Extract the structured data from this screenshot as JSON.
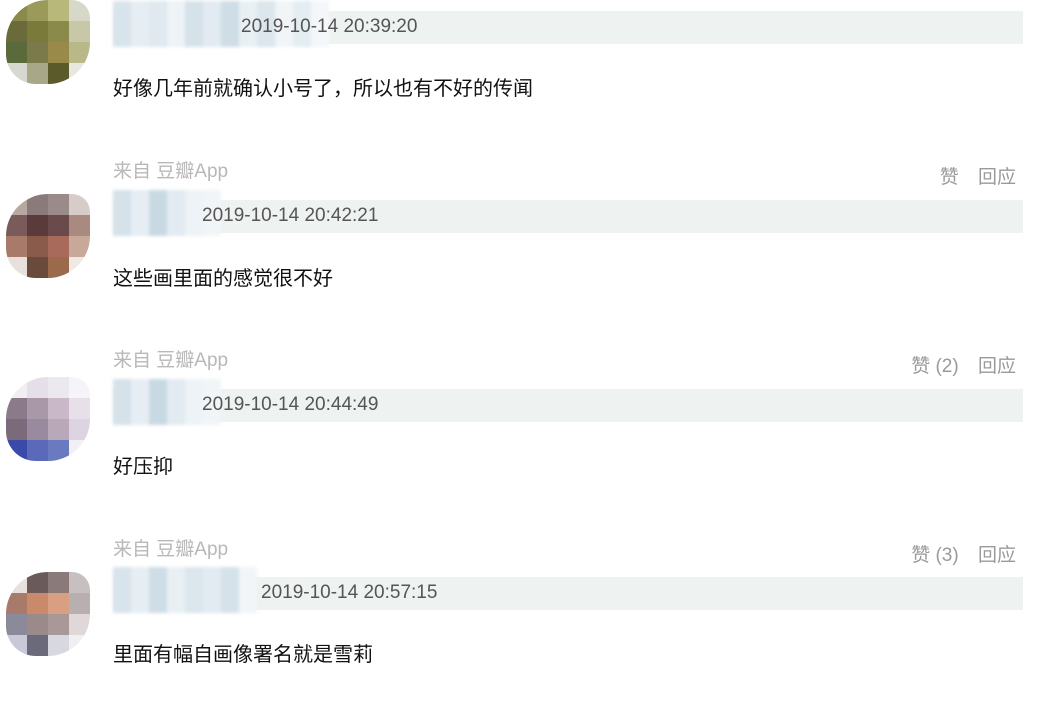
{
  "comments": [
    {
      "source": "",
      "like_label": "",
      "reply_label": "",
      "timestamp": "2019-10-14 20:39:20",
      "text": "好像几年前就确认小号了，所以也有不好的传闻",
      "avatar_colors": [
        "#8a8a4a",
        "#9a9a5a",
        "#b8b87a",
        "#d8d8c8",
        "#6a6a3a",
        "#7a7a3a",
        "#8a8a4a",
        "#c8c8a8",
        "#5a6a3a",
        "#7a7a4a",
        "#9a8a4a",
        "#b8b888",
        "#d8d8d0",
        "#a8a888",
        "#5a5a2a",
        "#e8e8e0"
      ],
      "username_colors": [
        "#d8e4ec",
        "#e6eef3",
        "#dfe9ef",
        "#edf3f6",
        "#d5e2ea",
        "#e2ebf1",
        "#cfdde6",
        "#e9f0f4",
        "#dbe6ed",
        "#f1f5f8",
        "#e4edf2",
        "#f4f7f9"
      ]
    },
    {
      "source": "来自 豆瓣App",
      "like_label": "赞",
      "reply_label": "回应",
      "timestamp": "2019-10-14 20:42:21",
      "text": "这些画里面的感觉很不好",
      "avatar_colors": [
        "#b8a8a0",
        "#8a7a7a",
        "#9a8a8a",
        "#d8ccc8",
        "#7a5a5a",
        "#5a3a3a",
        "#6a4a4a",
        "#a88a80",
        "#a87a6a",
        "#8a5a4a",
        "#a86a5a",
        "#c8a898",
        "#e8e0dc",
        "#6a4a3a",
        "#9a6a4a",
        "#f0e8e4"
      ],
      "username_colors": [
        "#d5e2ea",
        "#e6eef3",
        "#c9d9e3",
        "#e2ebf1",
        "#edf3f6",
        "#f1f5f8"
      ]
    },
    {
      "source": "来自 豆瓣App",
      "like_label": "赞 (2)",
      "reply_label": "回应",
      "timestamp": "2019-10-14 20:44:49",
      "text": "好压抑",
      "avatar_colors": [
        "#f0eef2",
        "#e4dfe8",
        "#ece8f0",
        "#f6f4f8",
        "#8a7a8a",
        "#a898a8",
        "#c8b8c8",
        "#e8e0e8",
        "#7a6a7a",
        "#9a8aa0",
        "#b8a8b8",
        "#dcd4e0",
        "#3a4aa8",
        "#5a6ab8",
        "#6a7ac0",
        "#f2f0f6"
      ],
      "username_colors": [
        "#d5e2ea",
        "#e6eef3",
        "#c9d9e3",
        "#e2ebf1",
        "#edf3f6",
        "#f1f5f8"
      ]
    },
    {
      "source": "来自 豆瓣App",
      "like_label": "赞 (3)",
      "reply_label": "回应",
      "timestamp": "2019-10-14 20:57:15",
      "text": "里面有幅自画像署名就是雪莉",
      "avatar_colors": [
        "#e8e0dc",
        "#6a5a5a",
        "#8a7a7a",
        "#c8c0c0",
        "#a87a6a",
        "#c88a6a",
        "#d8a080",
        "#b8b0b0",
        "#8a8a9a",
        "#9a8a8a",
        "#a89898",
        "#e0d8d8",
        "#c8c8d8",
        "#6a6a7a",
        "#d8d8e0",
        "#f0f0f2"
      ],
      "username_colors": [
        "#d8e4ec",
        "#e6eef3",
        "#cfdde6",
        "#e9f0f4",
        "#dbe6ed",
        "#e2ebf1",
        "#d5e2ea",
        "#f1f5f8"
      ]
    }
  ]
}
